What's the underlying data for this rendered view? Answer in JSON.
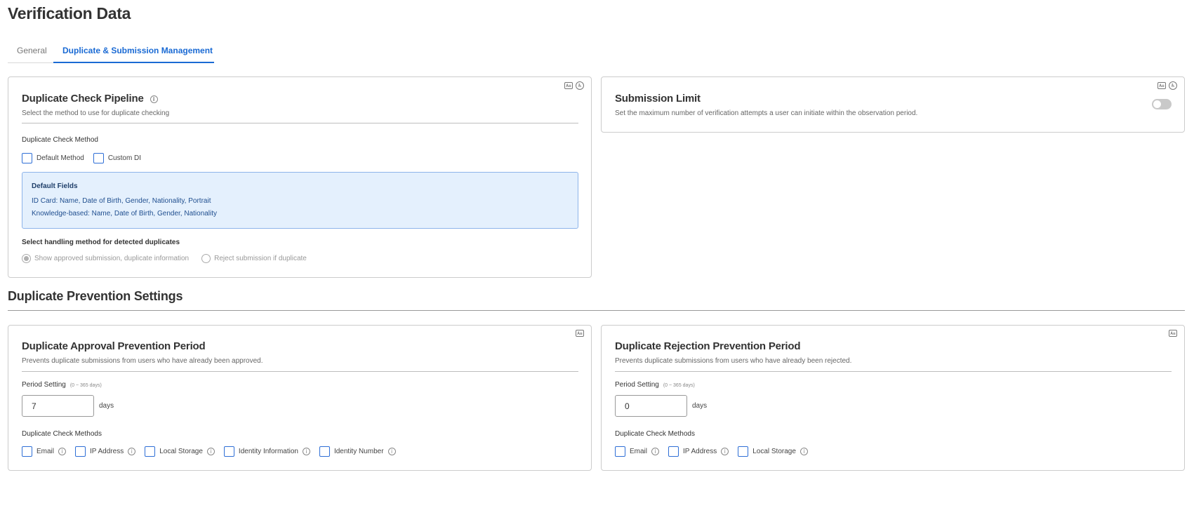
{
  "page": {
    "title": "Verification Data"
  },
  "tabs": [
    {
      "label": "General",
      "active": false
    },
    {
      "label": "Duplicate & Submission Management",
      "active": true
    }
  ],
  "colors": {
    "accent": "#1a6ad4",
    "checkbox_border": "#2f6fd6",
    "info_box_bg": "#e4f0fd",
    "info_box_border": "#8db4ea"
  },
  "pipeline": {
    "title": "Duplicate Check Pipeline",
    "subtitle": "Select the method to use for duplicate checking",
    "method_label": "Duplicate Check Method",
    "methods": [
      "Default Method",
      "Custom DI"
    ],
    "default_fields": {
      "title": "Default Fields",
      "lines": [
        "ID Card: Name, Date of Birth, Gender, Nationality, Portrait",
        "Knowledge-based: Name, Date of Birth, Gender, Nationality"
      ]
    },
    "handling_label": "Select handling method for detected duplicates",
    "handling_options": [
      {
        "label": "Show approved submission, duplicate information",
        "selected": true
      },
      {
        "label": "Reject submission if duplicate",
        "selected": false
      }
    ]
  },
  "submission_limit": {
    "title": "Submission Limit",
    "subtitle": "Set the maximum number of verification attempts a user can initiate within the observation period.",
    "enabled": false
  },
  "prevention": {
    "section_title": "Duplicate Prevention Settings",
    "approval": {
      "title": "Duplicate Approval Prevention Period",
      "subtitle": "Prevents duplicate submissions from users who have already been approved.",
      "period_label": "Period Setting",
      "period_range": "(0 ~ 365 days)",
      "period_value": "7",
      "unit": "days",
      "methods_label": "Duplicate Check Methods",
      "methods": [
        "Email",
        "IP Address",
        "Local Storage",
        "Identity Information",
        "Identity Number"
      ]
    },
    "rejection": {
      "title": "Duplicate Rejection Prevention Period",
      "subtitle": "Prevents duplicate submissions from users who have already been rejected.",
      "period_label": "Period Setting",
      "period_range": "(0 ~ 365 days)",
      "period_value": "0",
      "unit": "days",
      "methods_label": "Duplicate Check Methods",
      "methods": [
        "Email",
        "IP Address",
        "Local Storage"
      ]
    }
  }
}
